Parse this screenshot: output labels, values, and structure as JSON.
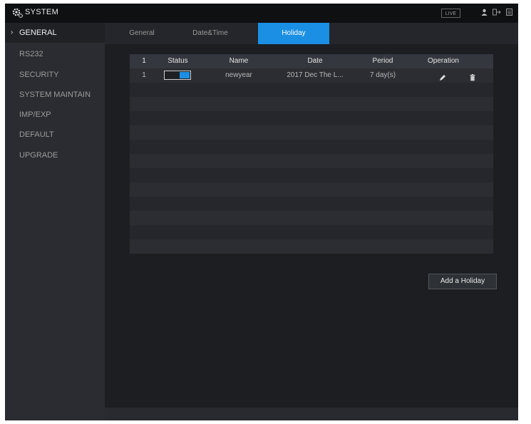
{
  "app": {
    "title": "SYSTEM",
    "live_label": "LIVE"
  },
  "sidebar": {
    "items": [
      {
        "label": "GENERAL",
        "active": true
      },
      {
        "label": "RS232"
      },
      {
        "label": "SECURITY"
      },
      {
        "label": "SYSTEM MAINTAIN"
      },
      {
        "label": "IMP/EXP"
      },
      {
        "label": "DEFAULT"
      },
      {
        "label": "UPGRADE"
      }
    ]
  },
  "tabs": [
    {
      "label": "General"
    },
    {
      "label": "Date&Time"
    },
    {
      "label": "Holiday",
      "active": true
    }
  ],
  "table": {
    "columns": [
      "1",
      "Status",
      "Name",
      "Date",
      "Period",
      "Operation"
    ],
    "rows": [
      {
        "index": "1",
        "status_on": true,
        "name": "newyear",
        "date": "2017 Dec The L...",
        "period": "7 day(s)"
      }
    ]
  },
  "add_button": {
    "label": "Add a Holiday"
  },
  "colors": {
    "accent": "#1a8fe3",
    "background": "#1c1e22",
    "sidebar": "#2a2c31"
  },
  "icons": {
    "gear": "gear-icon",
    "edit": "pencil-icon",
    "delete": "trash-icon",
    "user": "user-icon",
    "logout": "logout-icon",
    "menu": "menu-icon"
  }
}
